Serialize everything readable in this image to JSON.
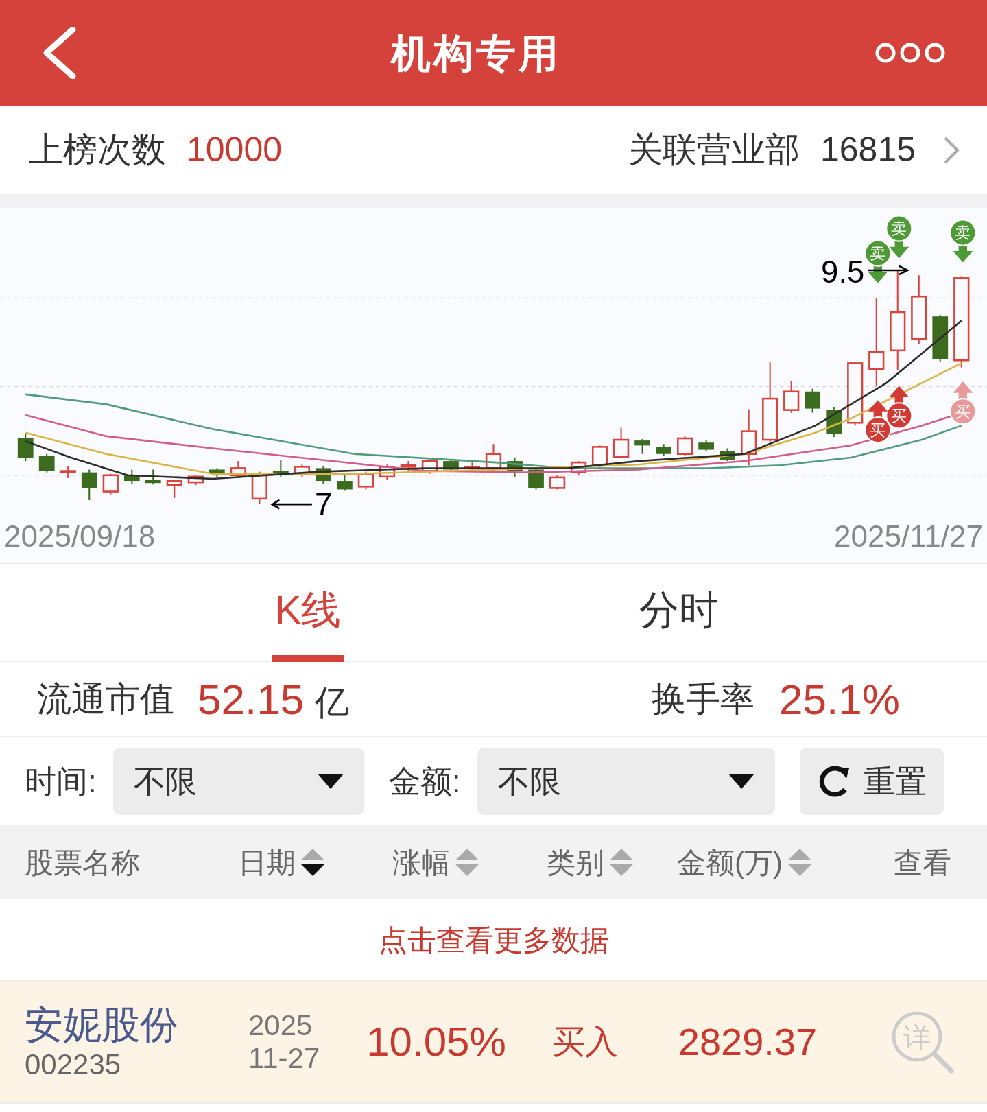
{
  "header": {
    "title": "机构专用"
  },
  "stats": {
    "count_label": "上榜次数",
    "count_value": "10000",
    "branches_label": "关联营业部",
    "branches_value": "16815"
  },
  "chart": {
    "start_date": "2025/09/18",
    "end_date": "2025/11/27",
    "markers": [
      {
        "label": "卖",
        "kind": "sell",
        "dimmed": false
      },
      {
        "label": "卖",
        "kind": "sell",
        "dimmed": false
      },
      {
        "label": "卖",
        "kind": "sell",
        "dimmed": false
      },
      {
        "label": "买",
        "kind": "buy",
        "dimmed": false
      },
      {
        "label": "买",
        "kind": "buy",
        "dimmed": false
      },
      {
        "label": "买",
        "kind": "buy",
        "dimmed": true
      }
    ],
    "annotations": [
      {
        "label": "9.5",
        "kind": "right"
      },
      {
        "label": "7",
        "kind": "left"
      }
    ]
  },
  "tabs": [
    {
      "label": "K线",
      "selected": true
    },
    {
      "label": "分时",
      "selected": false
    }
  ],
  "market": {
    "cap_label": "流通市值",
    "cap_value": "52.15",
    "cap_unit": "亿",
    "turnover_label": "换手率",
    "turnover_value": "25.1%"
  },
  "filters": [
    {
      "label": "时间:",
      "value": "不限"
    },
    {
      "label": "金额:",
      "value": "不限"
    }
  ],
  "reset_button": "重置",
  "table": {
    "columns": [
      {
        "label": "股票名称",
        "kind": "plain"
      },
      {
        "label": "日期",
        "kind": "sortable",
        "sorted_descending": true
      },
      {
        "label": "涨幅",
        "kind": "sortable",
        "sorted_descending": false
      },
      {
        "label": "类别",
        "kind": "sortable",
        "sorted_descending": false
      },
      {
        "label": "金额(万)",
        "kind": "sortable",
        "sorted_descending": false
      },
      {
        "label": "查看",
        "kind": "plain"
      }
    ],
    "more_link": "点击查看更多数据",
    "rows": [
      {
        "name": "安妮股份",
        "code": "002235",
        "date_year": "2025",
        "date_day": "11-27",
        "change": "10.05%",
        "type": "买入",
        "amount": "2829.37",
        "view_label": "详"
      }
    ]
  }
}
